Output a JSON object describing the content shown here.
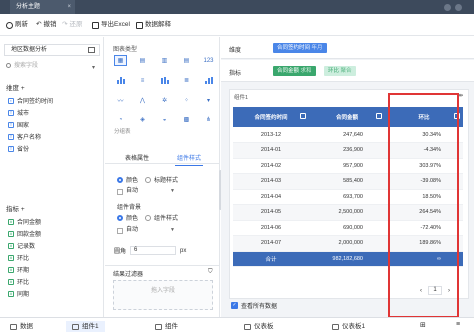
{
  "titlebar": {
    "tab": "分析主题",
    "close": "×"
  },
  "toolbar": {
    "refresh": "刷新",
    "undo": "撤销",
    "redo": "还原",
    "export_excel": "导出Excel",
    "data_explain": "数据解释"
  },
  "left": {
    "dataset": "地区数据分析",
    "search_placeholder": "搜索字段",
    "dimension_header": "维度",
    "dimensions": [
      "合同签约时间",
      "城市",
      "国家",
      "客户名称",
      "省份"
    ],
    "measure_header": "指标",
    "measures": [
      "合同金额",
      "回款金额",
      "记录数",
      "环比",
      "环期",
      "环比",
      "同期"
    ]
  },
  "middle": {
    "chart_type_label": "图表类型",
    "chart_type_123": "123",
    "chart_type_group": "分组表",
    "subtabs": {
      "table_attr": "表格属性",
      "component_style": "组件样式"
    },
    "color_label": "颜色",
    "title_style_label": "标题样式",
    "auto1": "自动",
    "component_bg": "组件背景",
    "color_label2": "颜色",
    "component_style_label": "组件样式",
    "auto2": "自动",
    "radius_label": "圆角",
    "radius_value": "6",
    "radius_unit": "px",
    "result_filter": "结果过滤器",
    "drop_hint": "拖入字段"
  },
  "right": {
    "dim_label": "维度",
    "dim_pill": "合同签约时间",
    "dim_pill_sub": "年月",
    "meas_label": "指标",
    "meas_pill1": "合同金额",
    "meas_pill1_sub": "求和",
    "meas_pill2": "环比",
    "meas_pill2_sub": "聚合",
    "widget_title": "组件1",
    "headers": [
      "合同签约时间",
      "合同金额",
      "环比"
    ],
    "rows": [
      [
        "2013-12",
        "247,640",
        "30.34%"
      ],
      [
        "2014-01",
        "236,900",
        "-4.34%"
      ],
      [
        "2014-02",
        "957,900",
        "303.97%"
      ],
      [
        "2014-03",
        "585,400",
        "-39.08%"
      ],
      [
        "2014-04",
        "693,700",
        "18.50%"
      ],
      [
        "2014-05",
        "2,500,000",
        "264.54%"
      ],
      [
        "2014-06",
        "690,000",
        "-72.40%"
      ],
      [
        "2014-07",
        "2,000,000",
        "189.86%"
      ]
    ],
    "total": [
      "合计",
      "982,182,680",
      "∞"
    ],
    "page": "1",
    "show_all": "查看所有数据"
  },
  "bottom": {
    "data_tab": "数据",
    "comp1_tab": "组件1",
    "comp_tab": "组件",
    "dash1_tab": "仪表板",
    "dash_tab": "仪表板1"
  }
}
